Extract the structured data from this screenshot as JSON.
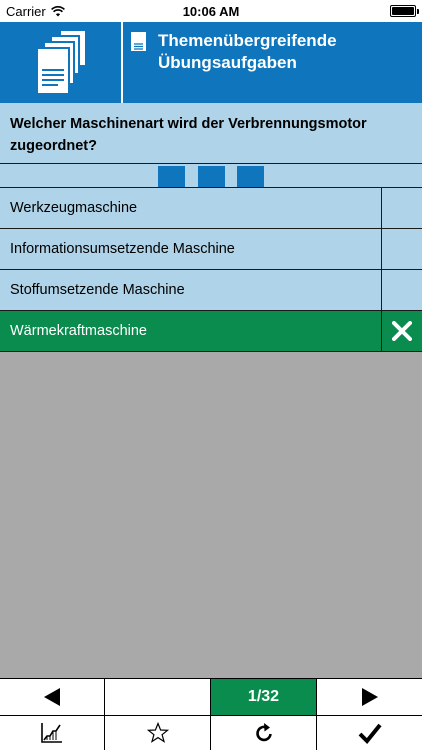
{
  "status_bar": {
    "carrier": "Carrier",
    "time": "10:06 AM",
    "battery_level": 1.0
  },
  "header": {
    "title": "Themenübergreifende\nÜbungsaufgaben",
    "icon": "documents-stack-icon",
    "title_icon": "document-icon"
  },
  "question": {
    "text": "Welcher Maschinenart wird der Verbrennungsmotor zugeordnet?"
  },
  "progress": {
    "segments": 3
  },
  "answers": [
    {
      "label": "Werkzeugmaschine",
      "selected": false
    },
    {
      "label": "Informationsumsetzende Maschine",
      "selected": false
    },
    {
      "label": "Stoffumsetzende Maschine",
      "selected": false
    },
    {
      "label": "Wärmekraftmaschine",
      "selected": true,
      "mark": "close-icon"
    }
  ],
  "navigation": {
    "prev_icon": "triangle-left-icon",
    "page_indicator": "1/32",
    "next_icon": "triangle-right-icon"
  },
  "toolbar": {
    "items": [
      "chart-icon",
      "star-icon",
      "refresh-icon",
      "checkmark-icon"
    ]
  },
  "colors": {
    "header_blue": "#0f75bc",
    "light_blue": "#afd3e8",
    "selected_green": "#0b8c4f",
    "background_gray": "#a9a9a9"
  }
}
